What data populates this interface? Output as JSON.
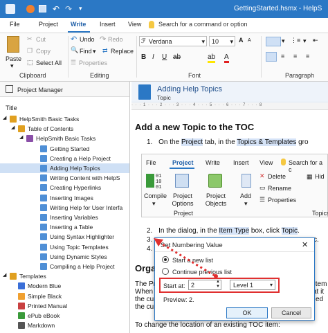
{
  "window": {
    "title": "GettingStarted.hsmx - HelpS"
  },
  "menu": {
    "file": "File",
    "project": "Project",
    "write": "Write",
    "insert": "Insert",
    "view": "View",
    "search_placeholder": "Search for a command or option"
  },
  "ribbon": {
    "paste": "Paste",
    "cut": "Cut",
    "copy": "Copy",
    "select_all": "Select All",
    "undo": "Undo",
    "redo": "Redo",
    "find": "Find",
    "replace": "Replace",
    "properties": "Properties",
    "font_name": "Verdana",
    "font_size": "10",
    "groups": {
      "clipboard": "Clipboard",
      "editing": "Editing",
      "font": "Font",
      "paragraph": "Paragraph"
    }
  },
  "project_manager": {
    "header": "Project Manager",
    "column_title": "Title",
    "tree": [
      "HelpSmith Basic Tasks",
      "Table of Contents",
      "HelpSmith Basic Tasks",
      "Getting Started",
      "Creating a Help Project",
      "Adding Help Topics",
      "Writing Content with HelpS",
      "Creating Hyperlinks",
      "Inserting Images",
      "Writing Help for User Interfa",
      "Inserting Variables",
      "Inserting a Table",
      "Using Syntax Highlighter",
      "Using Topic Templates",
      "Using Dynamic Styles",
      "Compiling a Help Project",
      "Templates",
      "Modern Blue",
      "Simple Black",
      "Printed Manual",
      "ePub eBook",
      "Markdown"
    ]
  },
  "topic": {
    "title": "Adding Help Topics",
    "subtitle": "Topic"
  },
  "document": {
    "heading": "Add a new Topic to the TOC",
    "step1_num": "1.",
    "step1_a": "On the ",
    "step1_project": "Project",
    "step1_b": " tab, in the ",
    "step1_tt": "Topics & Templates",
    "step1_c": " gro",
    "step2_num": "2.",
    "step2_a": "In the dialog, in the ",
    "step2_item": "Item Type",
    "step2_b": " box, click ",
    "step2_topic": "Topic",
    "step2_c": ".",
    "step3_num": "3.",
    "step3_tail": "c.",
    "step4_num": "4.",
    "section2": "Orga",
    "para1": "The Pro",
    "para1_tail": "t item",
    "para2": "When y",
    "para2_tail": "at it",
    "para3": "the cur",
    "para3_tail": "ed",
    "para4": "the cur",
    "para5": "To change the location of an existing TOC item:"
  },
  "embedded_ribbon": {
    "file": "File",
    "project": "Project",
    "write": "Write",
    "insert": "Insert",
    "view": "View",
    "search": "Search for a c",
    "compile": "Compile",
    "project_options": "Project Options",
    "project_objects": "Project Objects",
    "add": "Add",
    "delete": "Delete",
    "rename": "Rename",
    "properties": "Properties",
    "hide": "Hid",
    "group_project": "Project",
    "group_topics": "Topics"
  },
  "dialog": {
    "title": "Set Numbering Value",
    "option_new": "Start a new list",
    "option_continue": "Continue previous list",
    "start_at_label": "Start at:",
    "start_at_value": "2",
    "level_value": "Level 1",
    "preview": "Preview: 2.",
    "ok": "OK",
    "cancel": "Cancel"
  },
  "colors": {
    "accent": "#2b78c5",
    "annotation": "#e03030"
  }
}
